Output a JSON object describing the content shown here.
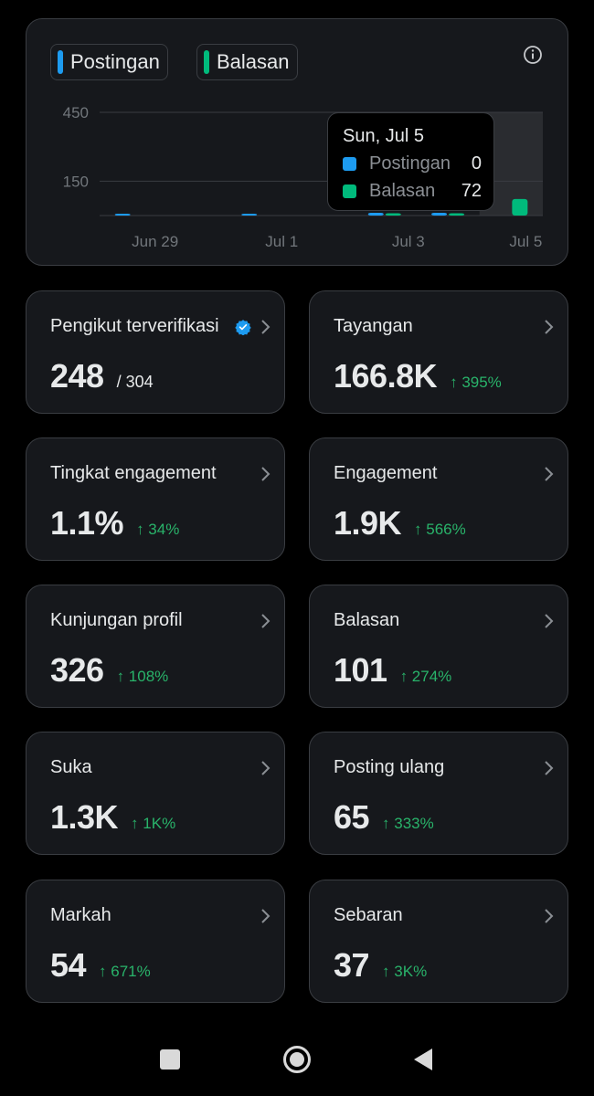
{
  "chart": {
    "legend": [
      {
        "label": "Postingan",
        "color": "#1d9bf0"
      },
      {
        "label": "Balasan",
        "color": "#00ba7c"
      }
    ],
    "info_icon": "info-icon",
    "tooltip": {
      "date": "Sun, Jul 5",
      "rows": [
        {
          "label": "Postingan",
          "value": "0",
          "color": "#1d9bf0"
        },
        {
          "label": "Balasan",
          "value": "72",
          "color": "#00ba7c"
        }
      ]
    }
  },
  "chart_data": {
    "type": "bar",
    "categories": [
      "Jun 29",
      "Jun 30",
      "Jul 1",
      "Jul 2",
      "Jul 3",
      "Jul 4",
      "Jul 5"
    ],
    "series": [
      {
        "name": "Postingan",
        "values": [
          2,
          0,
          1,
          0,
          12,
          12,
          0
        ]
      },
      {
        "name": "Balasan",
        "values": [
          0,
          0,
          0,
          0,
          10,
          10,
          72
        ]
      }
    ],
    "y_ticks": [
      "450",
      "150"
    ],
    "x_ticks": [
      "Jun 29",
      "Jul 1",
      "Jul 3",
      "Jul 5"
    ],
    "ylim": [
      0,
      450
    ],
    "grid": true,
    "highlight": "Jul 5"
  },
  "metrics": [
    {
      "label": "Pengikut terverifikasi",
      "value": "248",
      "sub": "/ 304",
      "verified_icon": "verified-badge-icon"
    },
    {
      "label": "Tayangan",
      "value": "166.8K",
      "change": "↑ 395%"
    },
    {
      "label": "Tingkat engagement",
      "value": "1.1%",
      "change": "↑ 34%"
    },
    {
      "label": "Engagement",
      "value": "1.9K",
      "change": "↑ 566%"
    },
    {
      "label": "Kunjungan profil",
      "value": "326",
      "change": "↑ 108%"
    },
    {
      "label": "Balasan",
      "value": "101",
      "change": "↑ 274%"
    },
    {
      "label": "Suka",
      "value": "1.3K",
      "change": "↑ 1K%"
    },
    {
      "label": "Posting ulang",
      "value": "65",
      "change": "↑ 333%"
    },
    {
      "label": "Markah",
      "value": "54",
      "change": "↑ 671%"
    },
    {
      "label": "Sebaran",
      "value": "37",
      "change": "↑ 3K%"
    }
  ],
  "navbar": {
    "icons": [
      "recents-square-icon",
      "home-circle-icon",
      "back-triangle-icon"
    ]
  },
  "colors": {
    "background": "#000000",
    "card": "#16181c",
    "border": "#3a3d42",
    "positive": "#29b36a"
  }
}
